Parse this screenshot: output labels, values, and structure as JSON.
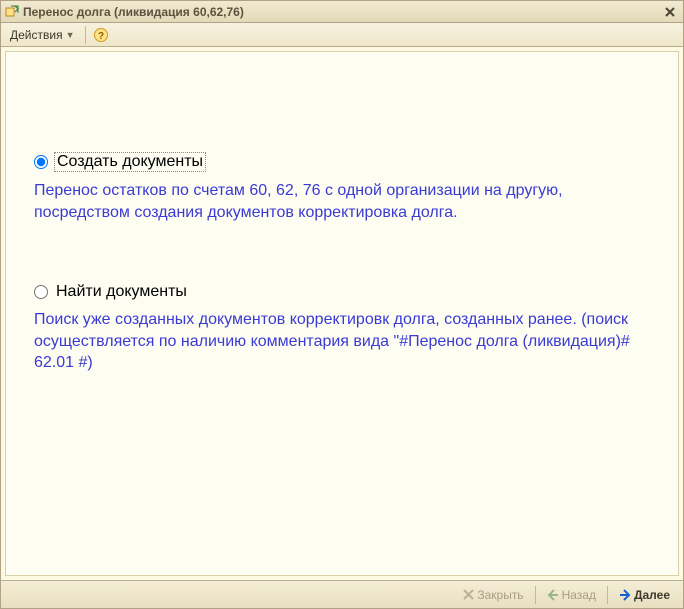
{
  "window": {
    "title": "Перенос долга (ликвидация 60,62,76)"
  },
  "toolbar": {
    "actions_label": "Действия"
  },
  "options": [
    {
      "label": "Создать документы",
      "description": "Перенос остатков по счетам 60, 62, 76 с одной организации на другую, посредством создания документов корректировка долга.",
      "selected": true
    },
    {
      "label": "Найти документы",
      "description": "Поиск уже созданных документов корректировк долга, созданных ранее. (поиск осуществляется по наличию комментария вида \"#Перенос долга (ликвидация)# 62.01 #)",
      "selected": false
    }
  ],
  "footer": {
    "close_label": "Закрыть",
    "back_label": "Назад",
    "next_label": "Далее"
  }
}
